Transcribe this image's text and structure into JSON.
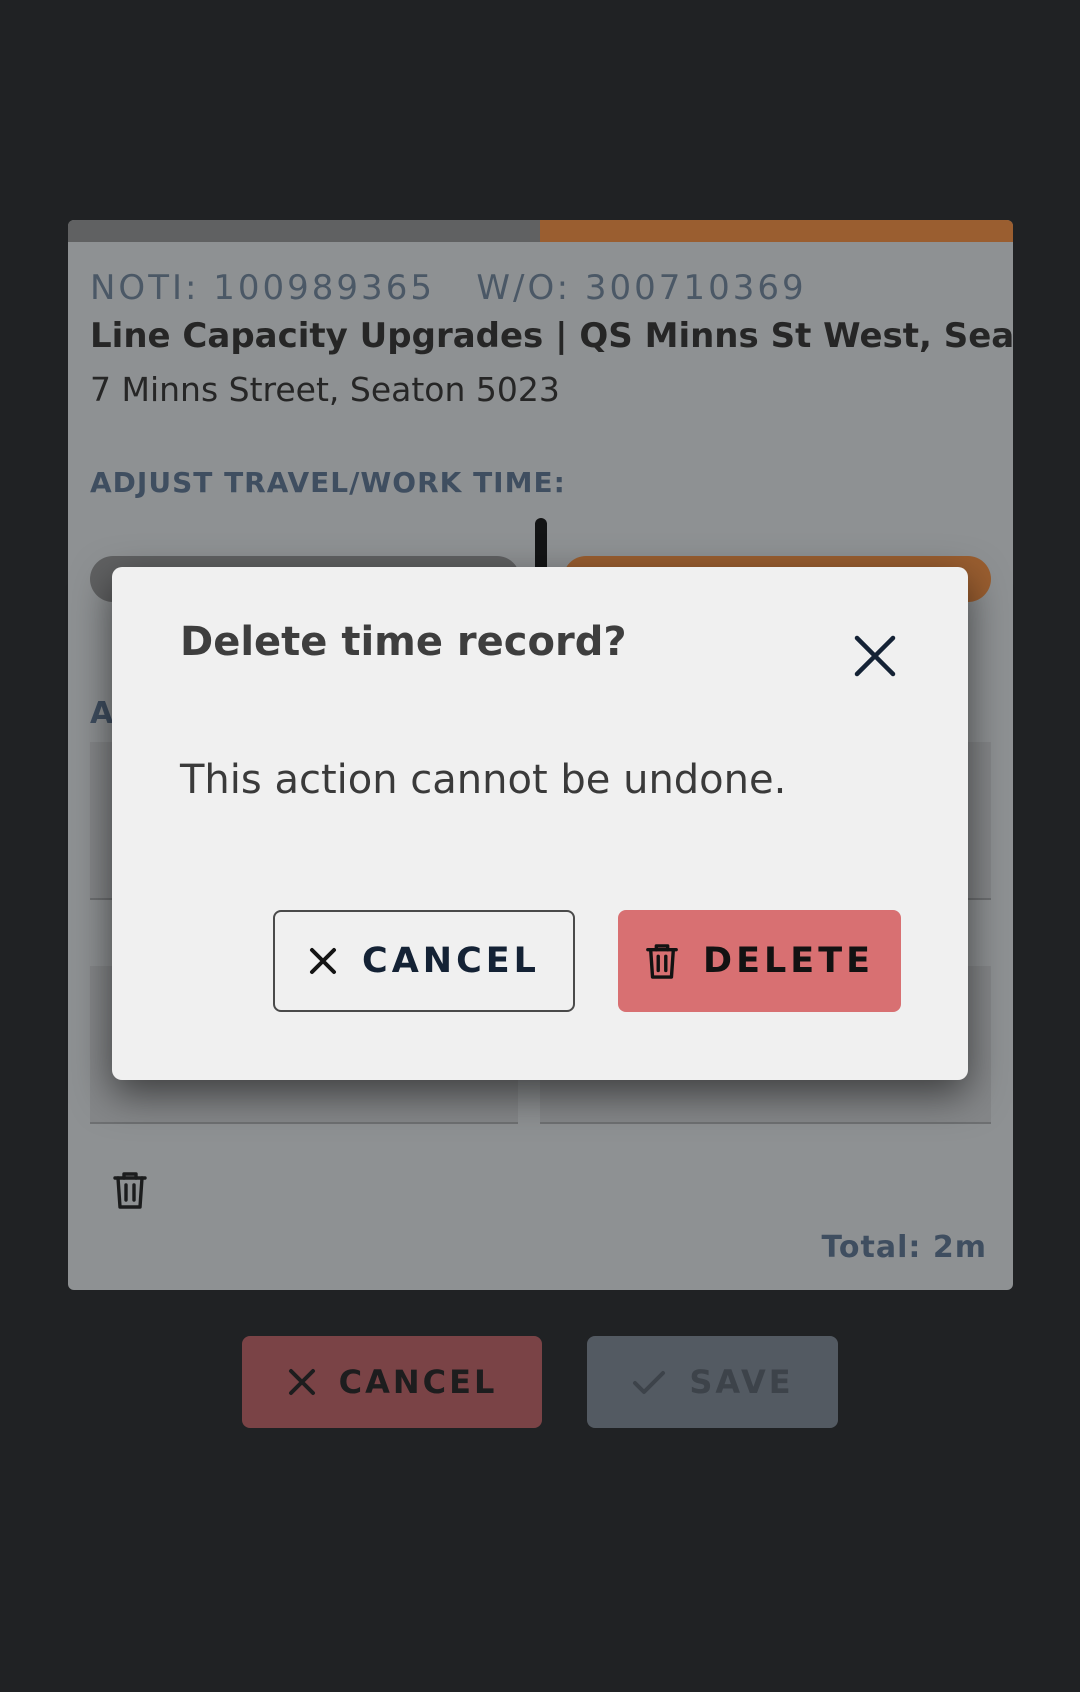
{
  "job": {
    "noti_label": "NOTI:",
    "noti_value": "100989365",
    "wo_label": "W/O:",
    "wo_value": "300710369",
    "title": "Line Capacity Upgrades | QS Minns St West, Seaton",
    "address": "7 Minns Street, Seaton 5023"
  },
  "time_adjust": {
    "label": "ADJUST TRAVEL/WORK TIME:",
    "section_letter": "A"
  },
  "summary": {
    "total": "Total: 2m"
  },
  "footer": {
    "cancel_label": "CANCEL",
    "save_label": "SAVE"
  },
  "dialog": {
    "title": "Delete time record?",
    "message": "This action cannot be undone.",
    "cancel_label": "CANCEL",
    "delete_label": "DELETE"
  },
  "colors": {
    "travel": "#606162",
    "work": "#9a5e30",
    "delete": "#d87072",
    "accent_text": "#3f4e60"
  }
}
